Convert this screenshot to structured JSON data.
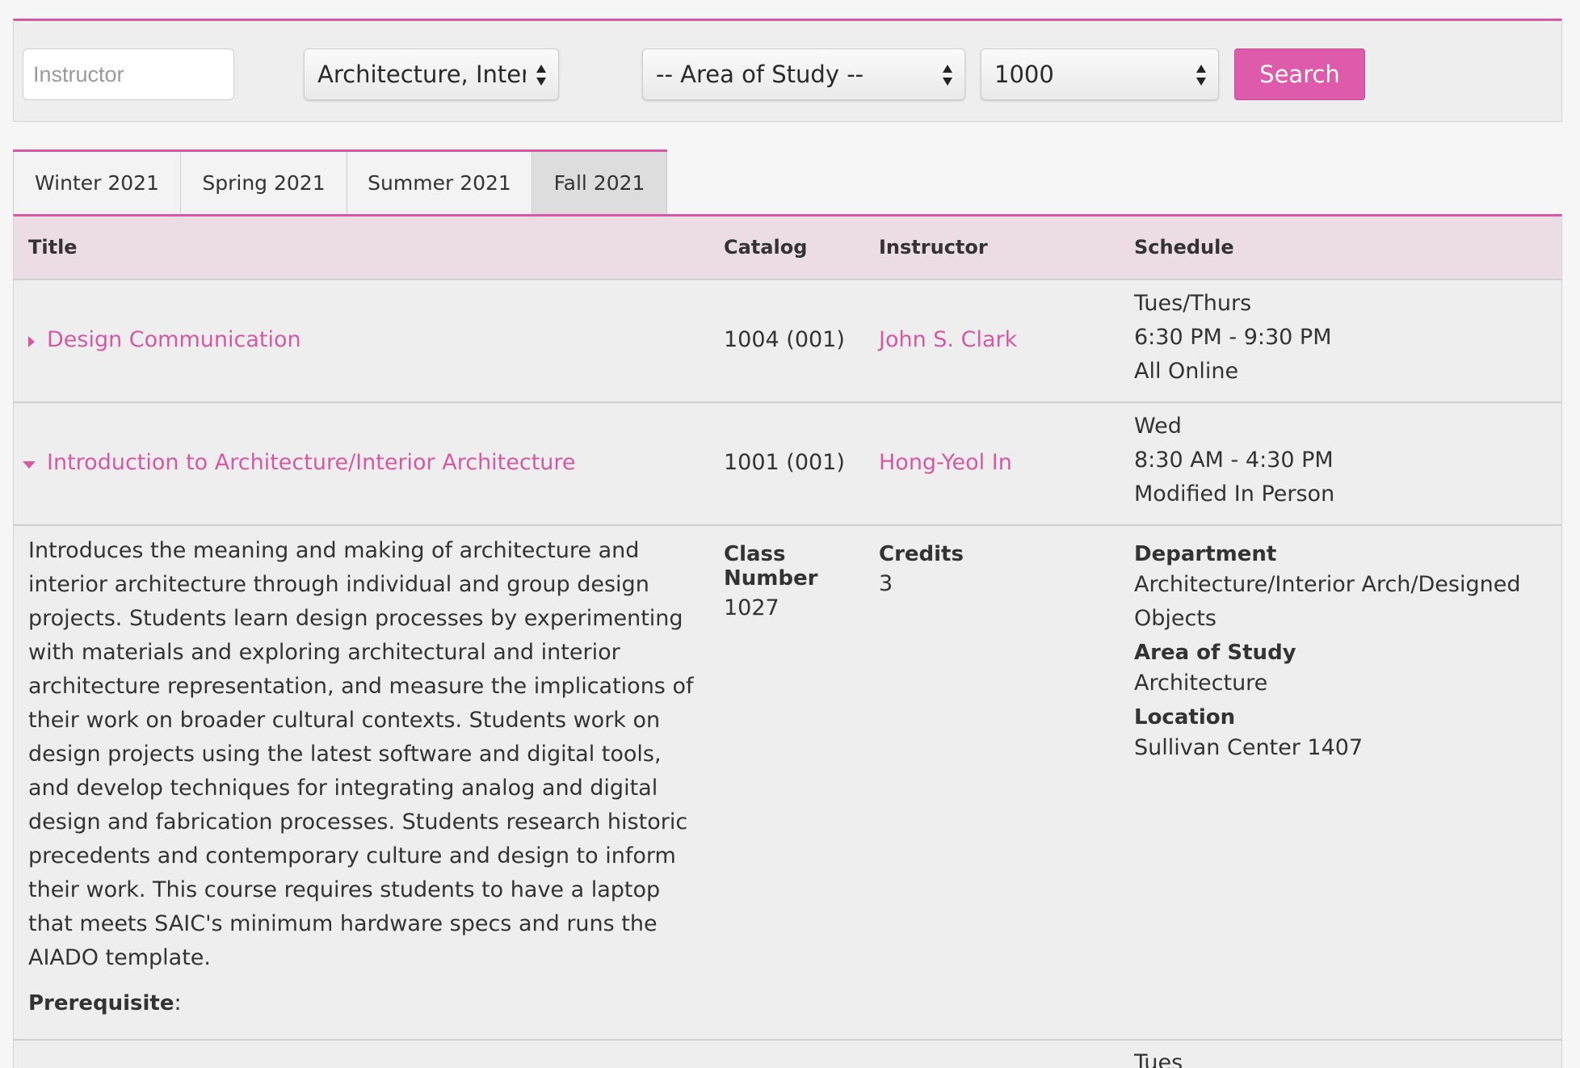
{
  "search": {
    "instructor_placeholder": "Instructor",
    "instructor_value": "",
    "department_selected": "Architecture, Interior A",
    "area_selected": "-- Area of Study --",
    "level_selected": "1000",
    "search_label": "Search"
  },
  "tabs": [
    {
      "label": "Winter 2021",
      "active": false
    },
    {
      "label": "Spring 2021",
      "active": false
    },
    {
      "label": "Summer 2021",
      "active": false
    },
    {
      "label": "Fall 2021",
      "active": true
    }
  ],
  "table": {
    "headers": {
      "title": "Title",
      "catalog": "Catalog",
      "instructor": "Instructor",
      "schedule": "Schedule"
    },
    "rows": [
      {
        "title": "Design Communication",
        "catalog": "1004 (001)",
        "instructor": "John S. Clark",
        "schedule": [
          "Tues/Thurs",
          "6:30 PM - 9:30 PM",
          "All Online"
        ],
        "expanded": false
      },
      {
        "title": "Introduction to Architecture/Interior Architecture",
        "catalog": "1001 (001)",
        "instructor": "Hong-Yeol In",
        "schedule": [
          "Wed",
          "8:30 AM - 4:30 PM",
          "Modified In Person"
        ],
        "expanded": true
      }
    ],
    "detail": {
      "description": "Introduces the meaning and making of architecture and interior architecture through individual and group design projects. Students learn design processes by experimenting with materials and exploring architectural and interior architecture representation, and measure the implications of their work on broader cultural contexts. Students work on design projects using the latest software and digital tools, and develop techniques for integrating analog and digital design and fabrication processes. Students research historic precedents and contemporary culture and design to inform their work. This course requires students to have a laptop that meets SAIC's minimum hardware specs and runs the AIADO template.",
      "prerequisite_label": "Prerequisite",
      "prerequisite_colon": ":",
      "class_number_label": "Class Number",
      "class_number": "1027",
      "credits_label": "Credits",
      "credits": "3",
      "department_label": "Department",
      "department": "Architecture/Interior Arch/Designed Objects",
      "area_label": "Area of Study",
      "area": "Architecture",
      "location_label": "Location",
      "location": "Sullivan Center 1407"
    },
    "next_row_schedule_peek": "Tues"
  },
  "colors": {
    "accent": "#d659a6",
    "link": "#d45aa4",
    "header_bg": "#ecdde5",
    "button_bg": "#dd5baa"
  },
  "icons": {
    "select_arrows": "updown-arrows-icon",
    "collapsed": "caret-right-icon",
    "expanded": "caret-down-icon"
  }
}
